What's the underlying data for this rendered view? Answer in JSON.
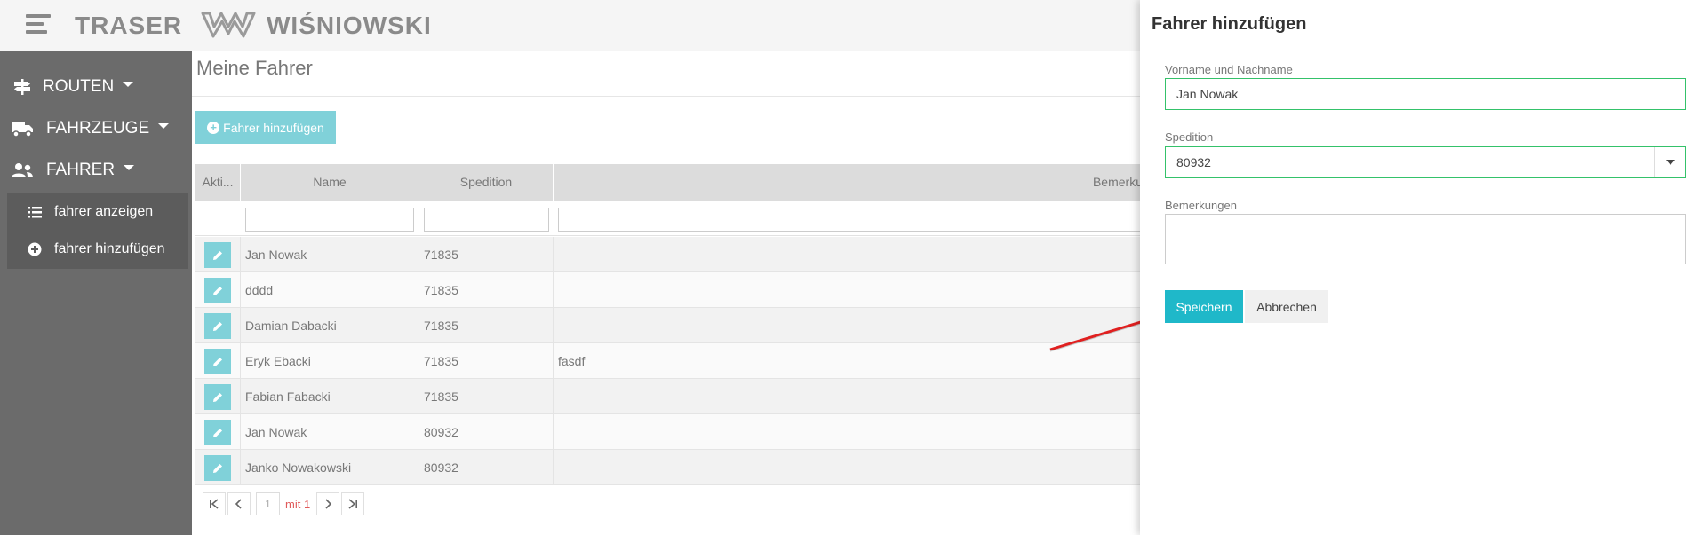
{
  "brand": {
    "name1": "TRASER",
    "name2": "WIŚNIOWSKI"
  },
  "sidebar": {
    "items": [
      {
        "label": "ROUTEN",
        "icon": "signpost-icon"
      },
      {
        "label": "FAHRZEUGE",
        "icon": "truck-icon"
      },
      {
        "label": "FAHRER",
        "icon": "users-icon"
      }
    ],
    "subitems": [
      {
        "label": "fahrer anzeigen",
        "icon": "list-icon"
      },
      {
        "label": "fahrer hinzufügen",
        "icon": "plus-circle-icon"
      }
    ]
  },
  "main": {
    "title": "Meine Fahrer",
    "add_button": "Fahrer hinzufügen",
    "columns": [
      "Akti...",
      "Name",
      "Spedition",
      "Bemerku"
    ],
    "rows": [
      {
        "name": "Jan Nowak",
        "spedition": "71835",
        "bemerkung": ""
      },
      {
        "name": "dddd",
        "spedition": "71835",
        "bemerkung": ""
      },
      {
        "name": "Damian Dabacki",
        "spedition": "71835",
        "bemerkung": ""
      },
      {
        "name": "Eryk Ebacki",
        "spedition": "71835",
        "bemerkung": "fasdf"
      },
      {
        "name": "Fabian Fabacki",
        "spedition": "71835",
        "bemerkung": ""
      },
      {
        "name": "Jan Nowak",
        "spedition": "80932",
        "bemerkung": ""
      },
      {
        "name": "Janko Nowakowski",
        "spedition": "80932",
        "bemerkung": ""
      }
    ],
    "pager": {
      "page": "1",
      "of_text": "mit 1"
    }
  },
  "panel": {
    "title": "Fahrer hinzufügen",
    "name_label": "Vorname und Nachname",
    "name_value": "Jan Nowak",
    "spedition_label": "Spedition",
    "spedition_value": "80932",
    "notes_label": "Bemerkungen",
    "save_label": "Speichern",
    "cancel_label": "Abbrechen"
  },
  "colors": {
    "accent": "#1fb8c9",
    "accent_light": "#80d1d9",
    "sidebar": "#6b6b6b",
    "arrow": "#e02020"
  }
}
